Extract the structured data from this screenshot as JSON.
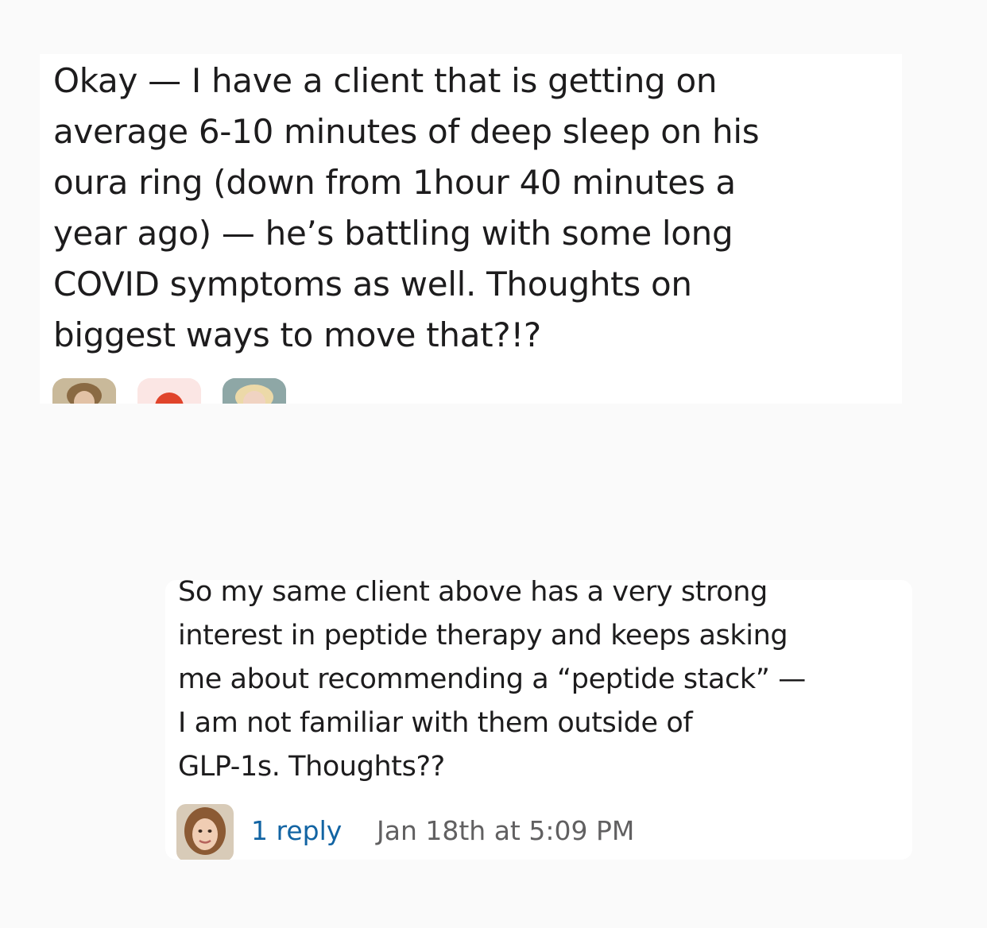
{
  "messages": [
    {
      "text": "Okay — I have a client that is getting on\naverage 6-10 minutes of deep sleep on his\noura ring (down from 1hour 40 minutes a\nyear ago) — he’s battling with some long\nCOVID symptoms as well. Thoughts on\nbiggest ways to move that?!?",
      "reply_avatars": [
        "avatar-person",
        "avatar-red-dot",
        "avatar-person"
      ]
    },
    {
      "text": "So my same client above has a very strong\ninterest in peptide therapy and keeps asking\nme about recommending a “peptide stack” —\nI am not familiar with them outside of\nGLP-1s. Thoughts??",
      "reply_count": "1 reply",
      "timestamp": "Jan 18th at 5:09 PM",
      "reply_avatars": [
        "avatar-person"
      ]
    }
  ],
  "colors": {
    "link": "#1264a3",
    "meta": "#616061",
    "text": "#1d1c1d",
    "background": "#fafafa",
    "card": "#ffffff"
  }
}
